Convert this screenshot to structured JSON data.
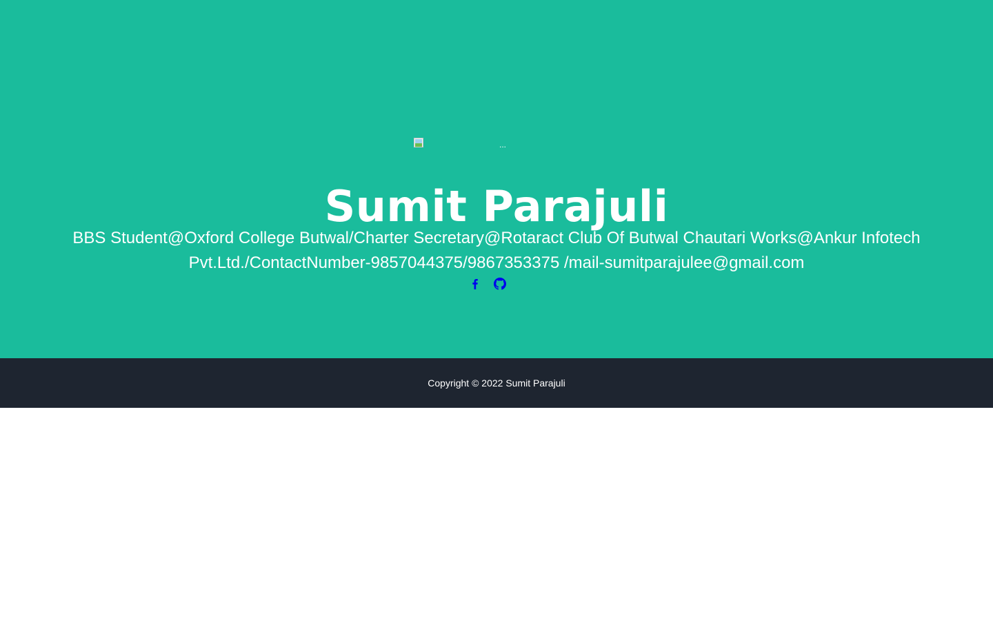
{
  "hero": {
    "background_color": "#1abc9c",
    "avatar_alt": "...",
    "name": "Sumit Parajuli",
    "tagline": "BBS Student@Oxford College Butwal/Charter Secretary@Rotaract Club Of Butwal Chautari Works@Ankur Infotech Pvt.Ltd./ContactNumber-9857044375/9867353375 /mail-sumitparajulee@gmail.com",
    "social_links": [
      {
        "icon": "facebook-icon"
      },
      {
        "icon": "github-icon"
      }
    ],
    "link_color": "#0000ee"
  },
  "footer": {
    "background_color": "#1e2530",
    "copyright": "Copyright © 2022 Sumit Parajuli"
  }
}
